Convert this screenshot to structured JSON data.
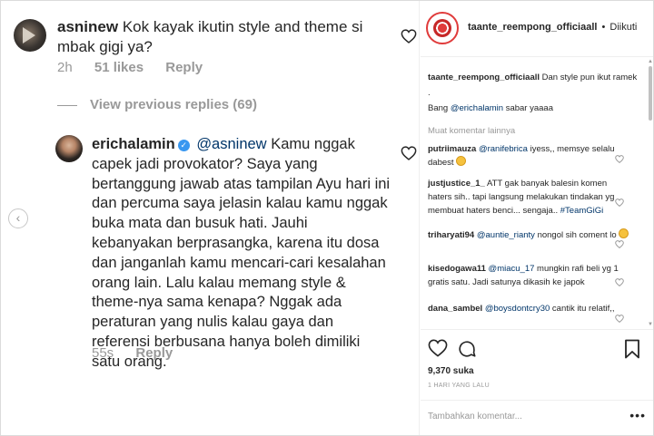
{
  "left": {
    "comment1": {
      "username": "asninew",
      "text": "Kok kayak ikutin style and theme si mbak gigi ya?",
      "time": "2h",
      "likes": "51 likes",
      "reply": "Reply"
    },
    "view_previous_replies": "View previous replies (69)",
    "comment2": {
      "username": "erichalamin",
      "mention": "@asninew",
      "text": "Kamu nggak capek jadi provokator? Saya yang bertanggung jawab atas tampilan Ayu hari ini dan percuma saya jelasin kalau kamu nggak buka mata dan busuk hati. Jauhi kebanyakan berprasangka, karena itu dosa dan janganlah kamu mencari-cari kesalahan orang lain. Lalu kalau memang style & theme-nya sama kenapa? Nggak ada peraturan yang nulis kalau gaya dan referensi berbusana hanya boleh dimiliki satu orang.",
      "time": "55s",
      "reply": "Reply"
    },
    "nav_prev": "‹"
  },
  "right": {
    "header": {
      "account": "taante_reempong_officiaall",
      "separator": "•",
      "follow_state": "Diikuti"
    },
    "caption": {
      "username": "taante_reempong_officiaall",
      "line1": "Dan style pun ikut ramek",
      "line2": ".",
      "line3_prefix": "Bang",
      "line3_mention": "@erichalamin",
      "line3_suffix": "sabar yaaaa"
    },
    "load_more": "Muat komentar lainnya",
    "comments": [
      {
        "username": "putriimauza",
        "mention": "@ranifebrica",
        "text": "iyess,, memsye selalu dabest",
        "emoji": true
      },
      {
        "username": "justjustice_1_",
        "mention": "",
        "text": "ATT gak banyak balesin komen haters sih.. tapi langsung melakukan tindakan yg membuat haters benci... sengaja..",
        "tag": "#TeamGiGi"
      },
      {
        "username": "triharyati94",
        "mention": "@auntie_rianty",
        "text": "nongol sih coment lo",
        "emoji": true
      },
      {
        "username": "kisedogawa11",
        "mention": "@miacu_17",
        "text": "mungkin rafi beli yg 1 gratis satu. Jadi satunya dikasih ke japok"
      },
      {
        "username": "dana_sambel",
        "mention": "@boysdontcry30",
        "text": "cantik itu relatif,,"
      }
    ],
    "likes": "9,370 suka",
    "time": "1 HARI YANG LALU",
    "add_comment_placeholder": "Tambahkan komentar...",
    "more_dots": "•••"
  },
  "colors": {
    "link": "#003569",
    "muted": "#999999",
    "verified": "#3897f0",
    "text": "#262626"
  }
}
